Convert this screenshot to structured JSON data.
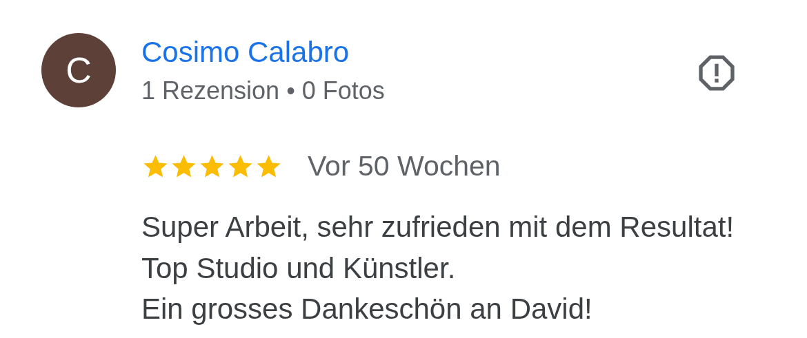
{
  "review": {
    "avatar_letter": "C",
    "author": "Cosimo Calabro",
    "meta": "1 Rezension • 0 Fotos",
    "stars": 5,
    "date": "Vor 50 Wochen",
    "text": "Super Arbeit, sehr zufrieden mit dem Resultat!\nTop Studio und Künstler.\nEin grosses Dankeschön an David!"
  }
}
